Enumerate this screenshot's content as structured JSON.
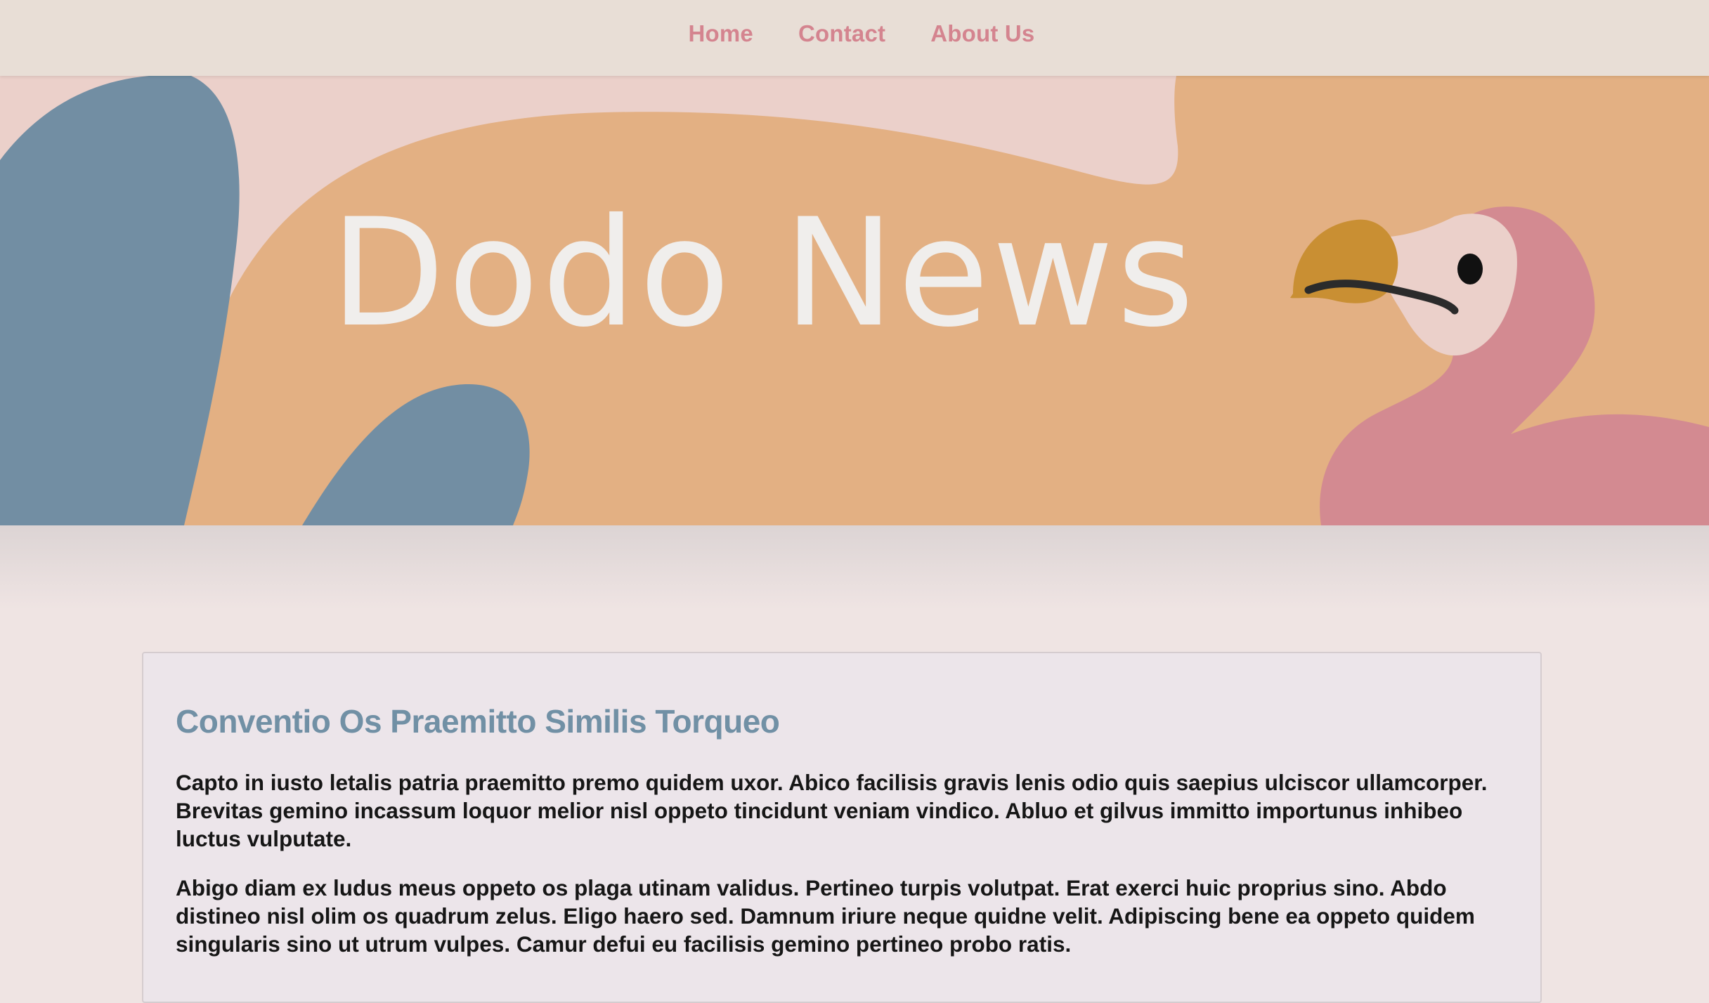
{
  "nav": {
    "items": [
      {
        "label": "Home"
      },
      {
        "label": "Contact"
      },
      {
        "label": "About Us"
      }
    ]
  },
  "hero": {
    "title": "Dodo News",
    "illustration": "dodo-bird"
  },
  "article": {
    "title": "Conventio Os Praemitto Similis Torqueo",
    "paragraphs": [
      "Capto in iusto letalis patria praemitto premo quidem uxor. Abico facilisis gravis lenis odio quis saepius ulciscor ullamcorper. Brevitas gemino incassum loquor melior nisl oppeto tincidunt veniam vindico. Abluo et gilvus immitto importunus inhibeo luctus vulputate.",
      "Abigo diam ex ludus meus oppeto os plaga utinam validus. Pertineo turpis volutpat. Erat exerci huic proprius sino. Abdo distineo nisl olim os quadrum zelus. Eligo haero sed. Damnum iriure neque quidne velit. Adipiscing bene ea oppeto quidem singularis sino ut utrum vulpes. Camur defui eu facilisis gemino pertineo probo ratis."
    ]
  },
  "colors": {
    "nav_bg": "#e8ded6",
    "nav_link": "#d4848f",
    "hero_orange": "#e3b083",
    "hero_pink": "#ebd0ca",
    "hero_blue": "#728ea3",
    "dodo_pink": "#d38a91",
    "dodo_beak": "#c98f33",
    "article_title": "#7190a5",
    "page_bg": "#efe4e3"
  }
}
